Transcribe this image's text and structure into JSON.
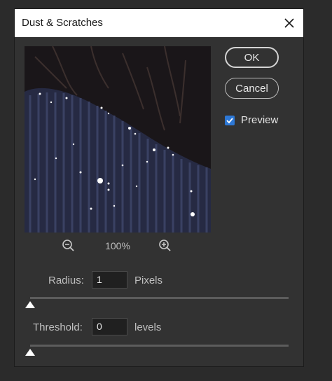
{
  "dialog": {
    "title": "Dust & Scratches",
    "close_icon": "close-icon"
  },
  "preview": {
    "zoom_level": "100%",
    "zoom_out_icon": "zoom-out-icon",
    "zoom_in_icon": "zoom-in-icon"
  },
  "buttons": {
    "ok_label": "OK",
    "cancel_label": "Cancel"
  },
  "preview_toggle": {
    "label": "Preview",
    "checked": true
  },
  "radius": {
    "label": "Radius:",
    "value": "1",
    "unit": "Pixels",
    "slider_fraction": 0
  },
  "threshold": {
    "label": "Threshold:",
    "value": "0",
    "unit": "levels",
    "slider_fraction": 0
  },
  "colors": {
    "background": "#323232",
    "titlebar": "#ffffff",
    "checkbox_accent": "#2d78d6",
    "field_bg": "#202020"
  }
}
